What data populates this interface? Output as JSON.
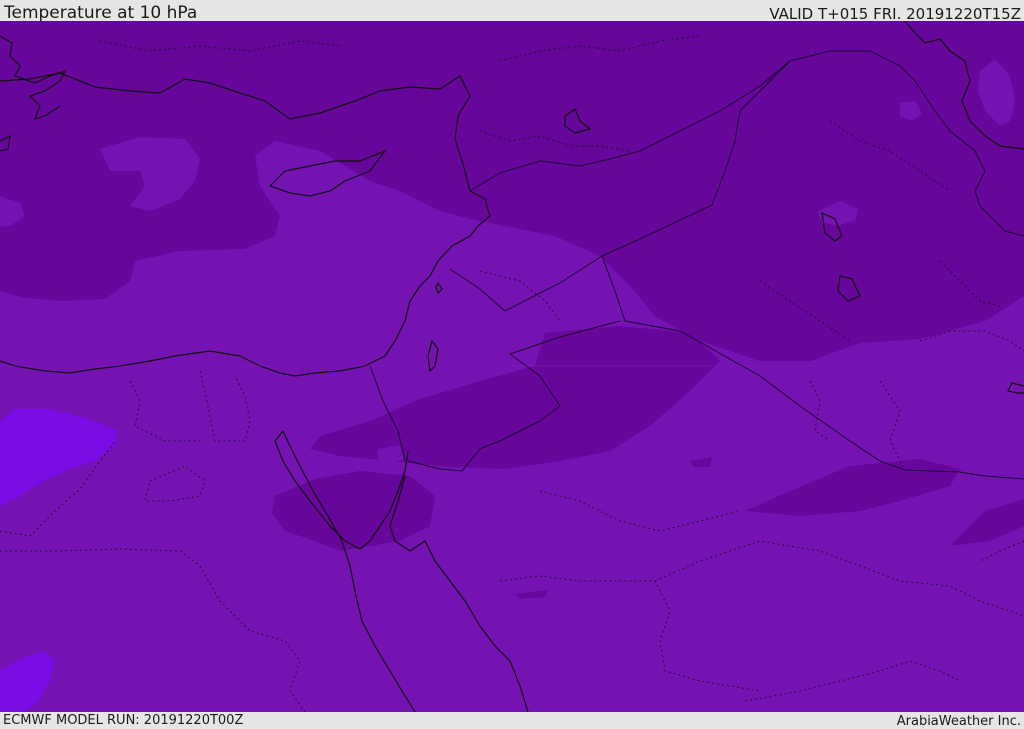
{
  "header": {
    "title": "Temperature at 10 hPa",
    "valid": "VALID T+015 FRI. 20191220T15Z"
  },
  "footer": {
    "model_run": "ECMWF MODEL RUN: 20191220T00Z",
    "credit": "ArabiaWeather Inc."
  },
  "map": {
    "variable": "temperature",
    "level": "10 hPa",
    "colors": {
      "base": "#7512b2",
      "dark": "#66069a",
      "warm": "#7c0ce6",
      "pale": "#8a2bc8",
      "coast": "#111111",
      "border": "#3a0a52"
    }
  }
}
